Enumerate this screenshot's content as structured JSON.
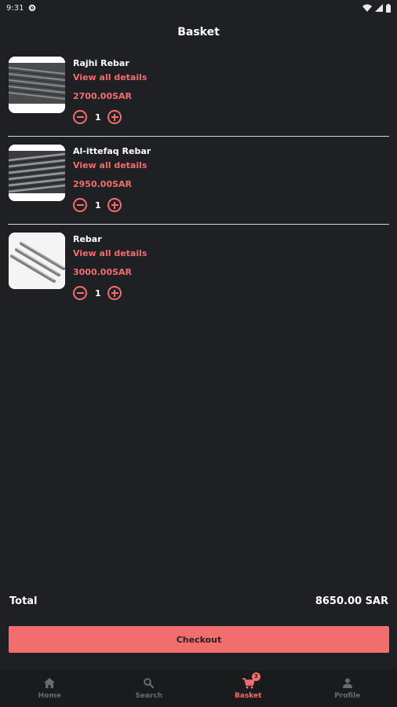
{
  "status_bar": {
    "time": "9:31"
  },
  "header": {
    "title": "Basket"
  },
  "basket": {
    "items": [
      {
        "name": "Rajhi Rebar",
        "details_link": "View all details",
        "price": "2700.00SAR",
        "quantity": "1"
      },
      {
        "name": "Al-ittefaq Rebar",
        "details_link": "View all details",
        "price": "2950.00SAR",
        "quantity": "1"
      },
      {
        "name": "Rebar",
        "details_link": "View all details",
        "price": "3000.00SAR",
        "quantity": "1"
      }
    ]
  },
  "summary": {
    "total_label": "Total",
    "total_value": "8650.00 SAR"
  },
  "checkout": {
    "label": "Checkout"
  },
  "nav": {
    "items": [
      {
        "label": "Home",
        "icon": "home-icon"
      },
      {
        "label": "Search",
        "icon": "search-icon"
      },
      {
        "label": "Basket",
        "icon": "cart-icon",
        "badge": "3",
        "active": true
      },
      {
        "label": "Profile",
        "icon": "person-icon"
      }
    ]
  },
  "colors": {
    "background": "#1f2023",
    "accent": "#f26d6d",
    "nav_inactive": "#6a6b6e"
  }
}
